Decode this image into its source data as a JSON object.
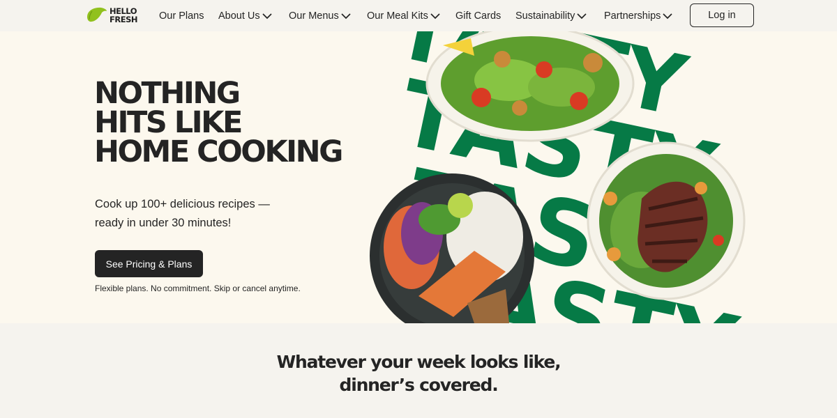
{
  "brand": {
    "logo_line1": "HELLO",
    "logo_line2": "FRESH",
    "accent": "#91c11e",
    "green": "#067a46"
  },
  "nav": {
    "items": [
      {
        "label": "Our Plans",
        "has_dropdown": false
      },
      {
        "label": "About Us",
        "has_dropdown": true
      },
      {
        "label": "Our Menus",
        "has_dropdown": true
      },
      {
        "label": "Our Meal Kits",
        "has_dropdown": true
      },
      {
        "label": "Gift Cards",
        "has_dropdown": false
      },
      {
        "label": "Sustainability",
        "has_dropdown": true
      },
      {
        "label": "Partnerships",
        "has_dropdown": true
      }
    ],
    "login_label": "Log in"
  },
  "hero": {
    "headline_lines": [
      "NOTHING",
      "HITS LIKE",
      "HOME COOKING"
    ],
    "subtitle_lines": [
      "Cook up 100+ delicious recipes —",
      "ready in under 30 minutes!"
    ],
    "cta_label": "See Pricing & Plans",
    "fine_print": "Flexible plans. No commitment. Skip or cancel anytime.",
    "art_word": "TASTY"
  },
  "section": {
    "title_lines": [
      "Whatever your week looks like,",
      "dinner’s covered."
    ]
  }
}
